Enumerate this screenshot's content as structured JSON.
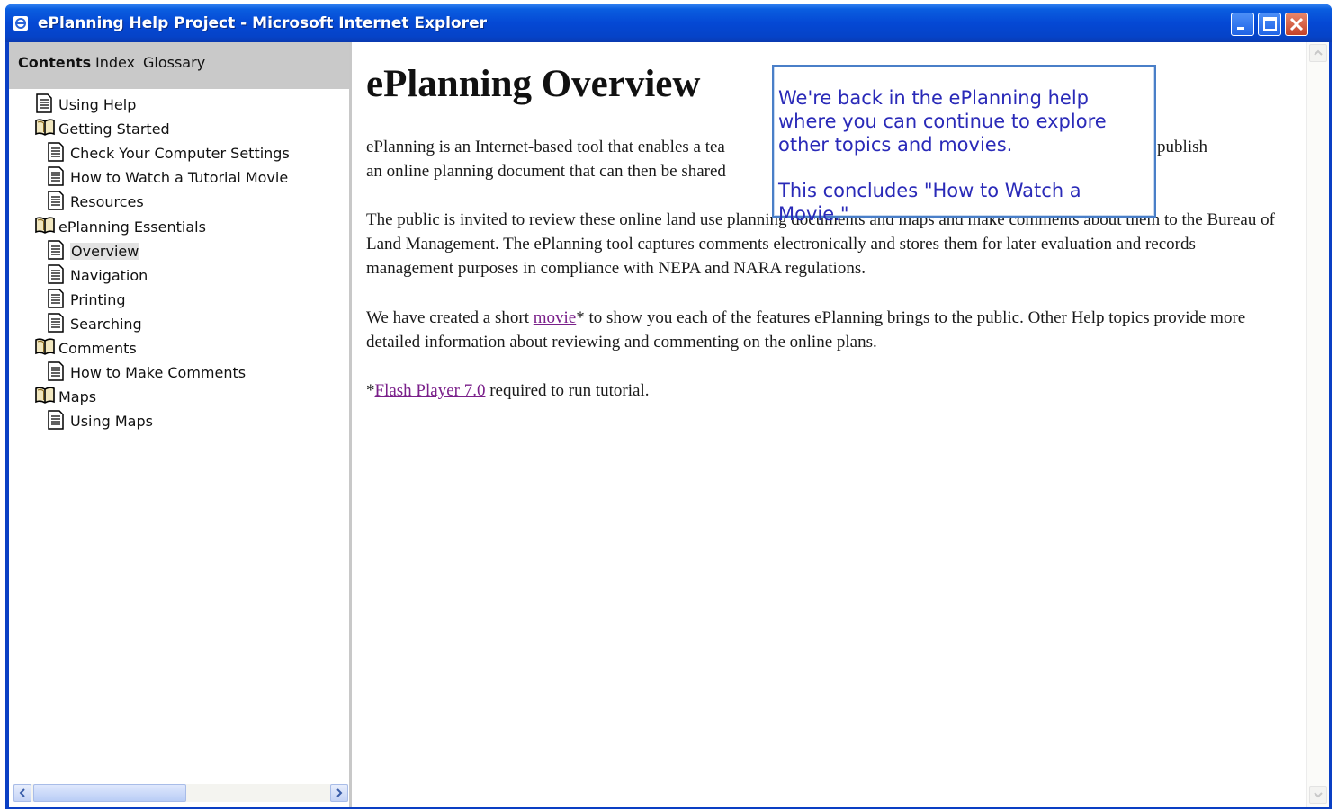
{
  "window": {
    "title": "ePlanning Help Project - Microsoft Internet Explorer"
  },
  "nav": {
    "tabs": [
      "Contents",
      "Index",
      "Glossary"
    ],
    "tree": [
      {
        "label": "Using Help",
        "type": "page",
        "level": 0
      },
      {
        "label": "Getting Started",
        "type": "book",
        "level": 0
      },
      {
        "label": "Check Your Computer Settings",
        "type": "page",
        "level": 1
      },
      {
        "label": "How to Watch a Tutorial Movie",
        "type": "page",
        "level": 1
      },
      {
        "label": "Resources",
        "type": "page",
        "level": 1
      },
      {
        "label": "ePlanning Essentials",
        "type": "book",
        "level": 0
      },
      {
        "label": "Overview",
        "type": "page",
        "level": 1,
        "selected": true
      },
      {
        "label": "Navigation",
        "type": "page",
        "level": 1
      },
      {
        "label": "Printing",
        "type": "page",
        "level": 1
      },
      {
        "label": "Searching",
        "type": "page",
        "level": 1
      },
      {
        "label": "Comments",
        "type": "book",
        "level": 0
      },
      {
        "label": "How to Make Comments",
        "type": "page",
        "level": 1
      },
      {
        "label": "Maps",
        "type": "book",
        "level": 0
      },
      {
        "label": "Using Maps",
        "type": "page",
        "level": 1
      }
    ]
  },
  "content": {
    "title": "ePlanning Overview",
    "para1_a": "ePlanning is an Internet-based tool that enables a tea",
    "para1_b": "w, and publish",
    "para1_c": "an online planning document that can then be shared",
    "para2": "The public is invited to review these online land use planning documents and maps and make comments about them to the Bureau of Land Management.  The ePlanning tool captures comments electronically and stores them for later evaluation and records management purposes in compliance with NEPA and NARA regulations.",
    "para3_pre": "We have created a short ",
    "para3_link": "movie",
    "para3_post": "* to show you each of the features ePlanning brings to the public. Other Help topics provide more detailed information about reviewing and commenting on the online plans.",
    "para4_pre": "*",
    "para4_link": "Flash Player 7.0",
    "para4_post": " required to run tutorial."
  },
  "callout": {
    "line1": "We're back in the ePlanning help where you can continue to explore other topics and movies.",
    "line2": "This concludes \"How to Watch a Movie.\""
  },
  "colors": {
    "titlebar": "#0548d4",
    "link": "#7a1f8a",
    "callout_text": "#2a2ab8",
    "callout_border": "#4a7fc8"
  }
}
